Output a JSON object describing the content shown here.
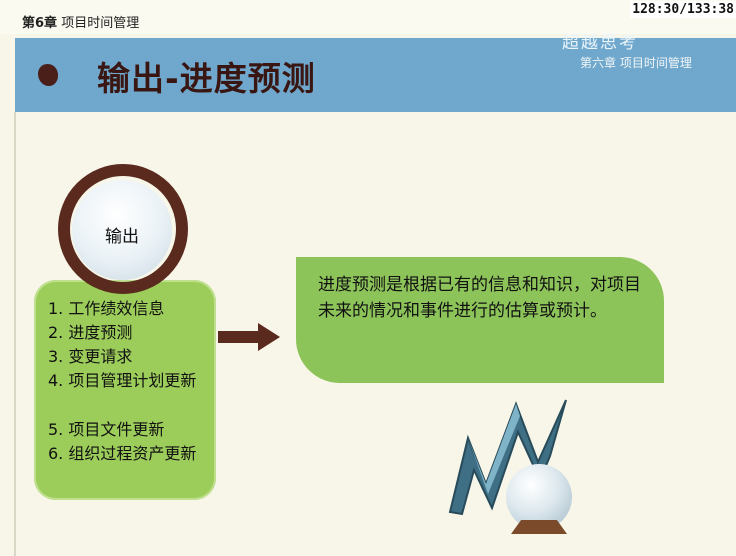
{
  "header": {
    "chapter_num": "第6章",
    "chapter_title": "项目时间管理",
    "page_counter": "128:30/133:38"
  },
  "banner": {
    "title": "输出-进度预测",
    "brand": "超越思考",
    "subtitle": "第六章 项目时间管理"
  },
  "diagram": {
    "circle_label": "输出",
    "outputs": [
      "1. 工作绩效信息",
      "2. 进度预测",
      "3. 变更请求",
      "4. 项目管理计划更新",
      "5. 项目文件更新",
      "6. 组织过程资产更新"
    ],
    "definition": "进度预测是根据已有的信息和知识，对项目未来的情况和事件进行的估算或预计。"
  },
  "colors": {
    "banner": "#6fa8cc",
    "title": "#3a1612",
    "ring": "#5a2a1f",
    "list_box": "#9ccc5a",
    "callout": "#8dc45a",
    "arrow": "#5a2a1f"
  },
  "icons": [
    "bullet-shape-icon",
    "right-arrow-icon",
    "zigzag-chart-icon",
    "crystal-ball-icon"
  ]
}
